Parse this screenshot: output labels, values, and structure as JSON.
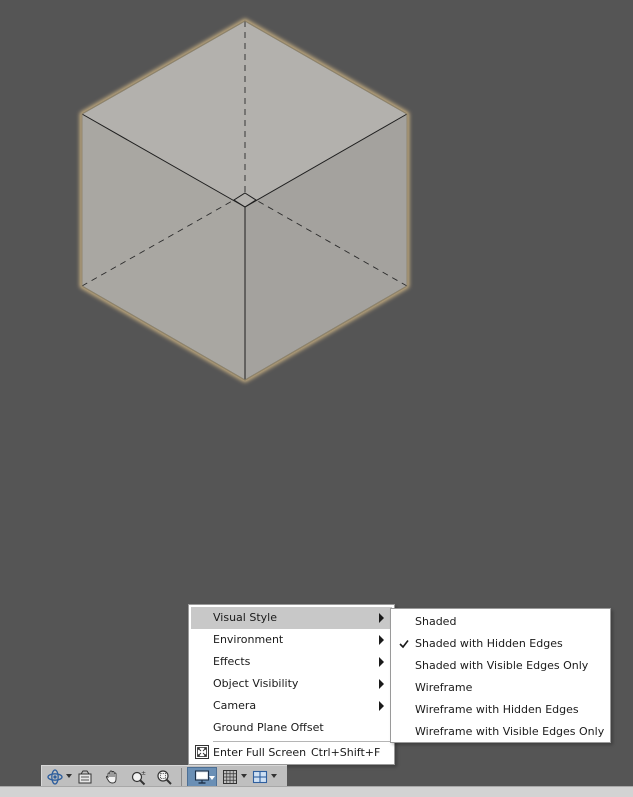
{
  "context_menu": {
    "items": [
      {
        "label": "Visual Style",
        "has_submenu": true,
        "highlighted": true
      },
      {
        "label": "Environment",
        "has_submenu": true
      },
      {
        "label": "Effects",
        "has_submenu": true
      },
      {
        "label": "Object Visibility",
        "has_submenu": true
      },
      {
        "label": "Camera",
        "has_submenu": true
      },
      {
        "label": "Ground Plane Offset",
        "has_submenu": false
      }
    ],
    "full_screen": {
      "label": "Enter Full Screen",
      "shortcut": "Ctrl+Shift+F",
      "icon": "fullscreen-icon"
    }
  },
  "visual_style_submenu": {
    "items": [
      {
        "label": "Shaded",
        "checked": false
      },
      {
        "label": "Shaded with Hidden Edges",
        "checked": true
      },
      {
        "label": "Shaded with Visible Edges Only",
        "checked": false
      },
      {
        "label": "Wireframe",
        "checked": false
      },
      {
        "label": "Wireframe with Hidden Edges",
        "checked": false
      },
      {
        "label": "Wireframe with Visible Edges Only",
        "checked": false
      }
    ]
  },
  "toolbar": {
    "buttons": [
      {
        "icon": "orbit-icon",
        "has_dropdown": true
      },
      {
        "icon": "look-at-icon"
      },
      {
        "icon": "pan-icon"
      },
      {
        "icon": "zoom-icon"
      },
      {
        "icon": "zoom-window-icon"
      },
      {
        "icon": "display-mode-icon",
        "has_dropdown": true,
        "active": true
      },
      {
        "icon": "grid-icon",
        "has_dropdown": true
      },
      {
        "icon": "multi-view-icon",
        "has_dropdown": true
      }
    ]
  },
  "colors": {
    "viewport_background": "#555555",
    "cube_face": "#a9a7a2",
    "cube_highlight": "#e8c98f",
    "menu_highlight": "#c8c8c8",
    "active_button": "#6a8fb5"
  }
}
